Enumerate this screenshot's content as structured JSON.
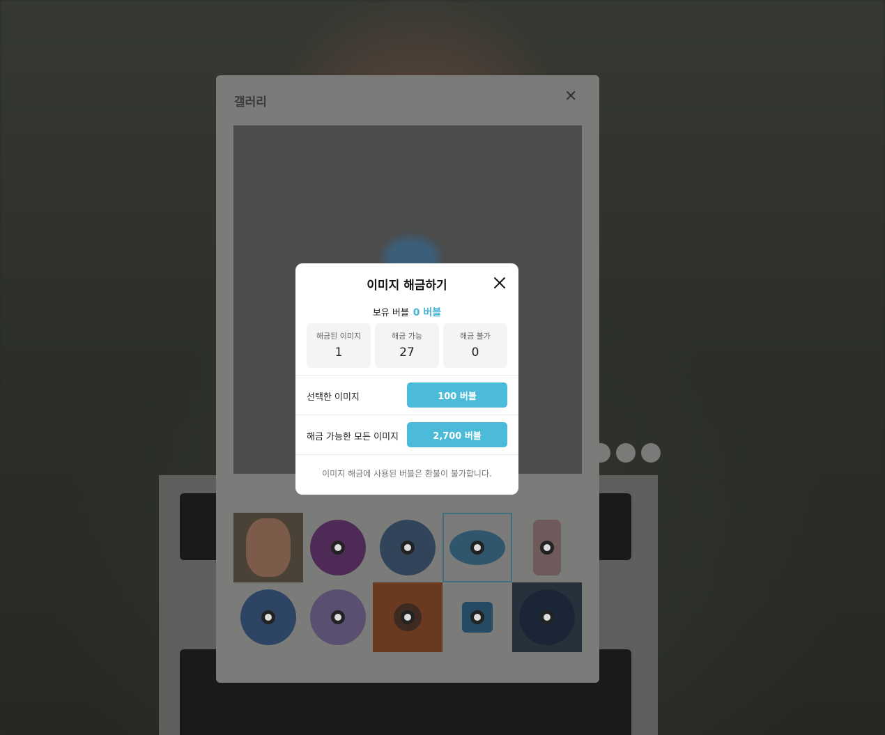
{
  "gallery": {
    "title": "갤러리",
    "thumbnails": [
      {
        "name": "avatar-photo",
        "selected": false
      },
      {
        "name": "purple-logo",
        "selected": false
      },
      {
        "name": "blue-hex-logo",
        "selected": false
      },
      {
        "name": "docker-logo",
        "selected": true
      },
      {
        "name": "java-logo",
        "selected": false
      },
      {
        "name": "blue-round-logo",
        "selected": false
      },
      {
        "name": "gradient-logo",
        "selected": false
      },
      {
        "name": "orange-logo",
        "selected": false
      },
      {
        "name": "blue-square-logo",
        "selected": false
      },
      {
        "name": "dark-logo",
        "selected": false
      }
    ]
  },
  "modal": {
    "title": "이미지 해금하기",
    "balance_label": "보유 버블",
    "balance_value": "0 버블",
    "stats": [
      {
        "label": "해금된 이미지",
        "value": "1"
      },
      {
        "label": "해금 가능",
        "value": "27"
      },
      {
        "label": "해금 불가",
        "value": "0"
      }
    ],
    "selected_label": "선택한 이미지",
    "selected_button": "100 버블",
    "all_label": "해금 가능한 모든 이미지",
    "all_button": "2,700 버블",
    "notice": "이미지 해금에 사용된 버블은 환불이 불가합니다."
  },
  "colors": {
    "accent": "#4bbbd9",
    "balance": "#47b4d3"
  }
}
